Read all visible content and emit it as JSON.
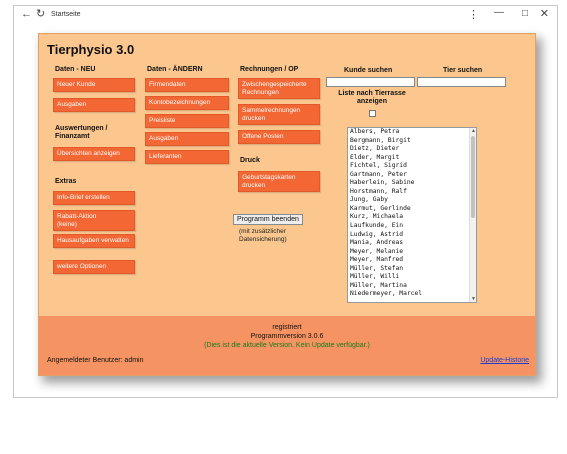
{
  "browser": {
    "tab_title": "Startseite",
    "back_icon": "arrow-left-icon",
    "reload_icon": "reload-icon",
    "menu_icon": "kebab-menu-icon",
    "minimize_icon": "minimize-icon",
    "maximize_icon": "maximize-icon",
    "close_icon": "close-icon"
  },
  "app": {
    "title": "Tierphysio 3.0"
  },
  "col1": {
    "heading": "Daten - NEU",
    "btn_neuer_kunde": "Neuer Kunde",
    "btn_ausgaben": "Ausgaben",
    "heading_auswertungen": "Auswertungen / Finanzamt",
    "btn_uebersichten": "Übersichten anzeigen",
    "heading_extras": "Extras",
    "btn_infobrief": "Info-Brief erstellen",
    "btn_rabatt": "Rabatt-Aktion",
    "btn_rabatt_sub": "(keine)",
    "btn_hausaufgaben": "Hausaufgaben verwalten",
    "btn_weitere": "weitere Optionen"
  },
  "col2": {
    "heading": "Daten - ÄNDERN",
    "btn_firmendaten": "Firmendaten",
    "btn_kontobezeichnungen": "Kontobezeichnungen",
    "btn_preisliste": "Preisliste",
    "btn_ausgaben": "Ausgaben",
    "btn_lieferanten": "Lieferanten"
  },
  "col3": {
    "heading": "Rechnungen / OP",
    "btn_zwischen": "Zwischengespeicherte Rechnungen",
    "btn_sammel": "Sammelrechnungen drucken",
    "btn_offene": "Offene Posten",
    "heading_druck": "Druck",
    "btn_geburtstag": "Geburtstagskarten drucken",
    "btn_beenden": "Programm beenden",
    "beenden_note": "(mit zusätzlicher Datensicherung)"
  },
  "search": {
    "kunde_label": "Kunde suchen",
    "tier_label": "Tier suchen",
    "liste_label": "Liste nach Tierrasse anzeigen",
    "kunde_value": "",
    "tier_value": ""
  },
  "customers": [
    "Albers, Petra",
    "Bergmann, Birgit",
    "Dietz, Dieter",
    "Elder, Margit",
    "Fichtel, Sigrid",
    "Gartmann, Peter",
    "Haberlein, Sabine",
    "Horstmann, Ralf",
    "Jung, Gaby",
    "Karmut, Gerlinde",
    "Kurz, Michaela",
    "Laufkunde, Ein",
    "Ludwig, Astrid",
    "Mania, Andreas",
    "Meyer, Melanie",
    "Meyer, Manfred",
    "Müller, Stefan",
    "Müller, Willi",
    "Müller, Martina",
    "Niedermeyer, Marcel"
  ],
  "footer": {
    "registered": "registriert",
    "version": "Programmversion 3.0.6",
    "update_status": "(Dies ist die aktuelle Version. Kein Update verfügbar.)",
    "user": "Angemeldeter Benutzer: admin",
    "history_link": "Update-Historie"
  },
  "colors": {
    "card_bg": "#fbc78f",
    "button": "#f26734",
    "footer_bg": "#f59363",
    "update_green": "#1a7a1a",
    "link_blue": "#1a3fd0"
  }
}
